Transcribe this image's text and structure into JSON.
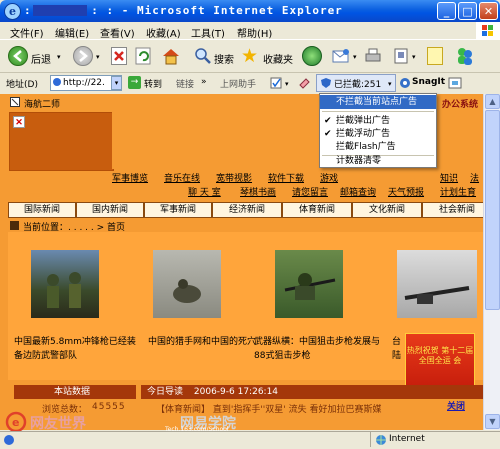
{
  "window": {
    "title": "Microsoft Internet Explorer",
    "title_prefix": "::",
    "title_mid": ": :  -",
    "buttons": {
      "minimize": "_",
      "maximize": "□",
      "close": "✕"
    }
  },
  "menu": [
    "文件(F)",
    "编辑(E)",
    "查看(V)",
    "收藏(A)",
    "工具(T)",
    "帮助(H)"
  ],
  "toolbar": {
    "back_label": "后退",
    "search_label": "搜索",
    "favorites_label": "收藏夹"
  },
  "address_bar": {
    "label": "地址(D)",
    "url": "http://22.",
    "go_label": "转到",
    "links_label": "链接",
    "helper_label": "上网助手",
    "blocked_label": "已拦截:251",
    "snagit_label": "SnagIt"
  },
  "page": {
    "site_name": "海航二师",
    "top_right_text": "办公系统",
    "nav_row1": [
      "军事博览",
      "音乐在线",
      "宽带视影",
      "软件下载",
      "游戏",
      "知识",
      "法"
    ],
    "nav_row2": [
      "聊 天 室",
      "琴棋书画",
      "请您留言",
      "邮箱查询",
      "天气预报",
      "计划生育"
    ],
    "tabs": [
      "国际新闻",
      "国内新闻",
      "军事新闻",
      "经济新闻",
      "体育新闻",
      "文化新闻",
      "社会新闻"
    ],
    "breadcrumb": "当前位置：. . . . . > 首页",
    "captions": [
      "中国最新5.8mm冲锋枪已经装备边防武警部队",
      "中国的猎手网和中国的死穴",
      "武器纵横：中国狙击步枪发展与88式狙击步枪",
      "台 陆"
    ],
    "promo_text": "热烈祝贺 第十二届 全国全运 会",
    "promo_link": "关闭",
    "stats_header": "本站数据",
    "guide_header": "今日导读",
    "guide_date": "2006-9-6 17:26:14",
    "visits_label": "浏览总数：",
    "visits_value": "45555",
    "guide_item": "【体育新闻】 直到'指挥手''双星' 流失 看好加拉巴赛斯媒"
  },
  "dropdown": {
    "items": [
      {
        "label": "不拦截当前站点广告",
        "checked": false,
        "highlighted": true
      },
      {
        "label": "拦截弹出广告",
        "checked": true,
        "highlighted": false
      },
      {
        "label": "拦截浮动广告",
        "checked": true,
        "highlighted": false
      },
      {
        "label": "拦截Flash广告",
        "checked": false,
        "highlighted": false
      },
      {
        "label": "计数器清零",
        "checked": false,
        "highlighted": false
      }
    ]
  },
  "watermark": {
    "cn_text": "网友世界",
    "mid_text": "网易学院",
    "url": "Tech.163.com/School"
  },
  "status_bar": {
    "zone": "Internet"
  },
  "colors": {
    "page_bg": "#F59B33",
    "dark_block": "#C85D0E",
    "header_bar": "#A4370A",
    "menu_highlight": "#316AC5",
    "titlebar": "#0054E3"
  }
}
